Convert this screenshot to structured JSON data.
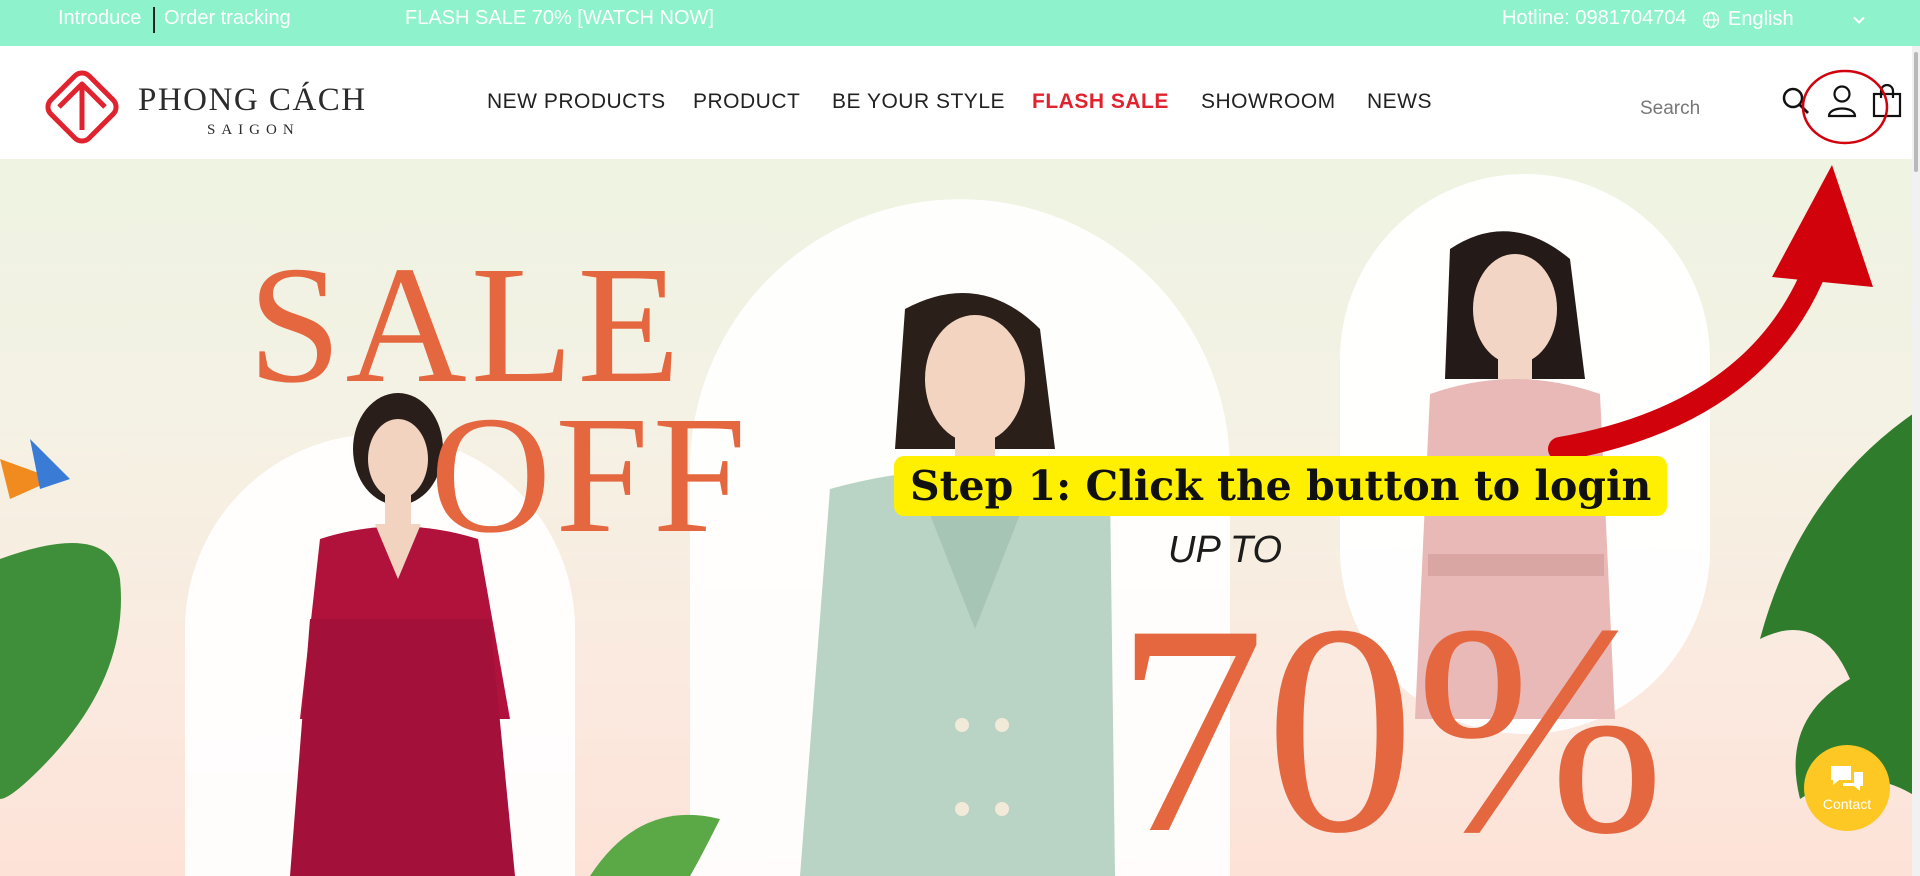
{
  "topbar": {
    "introduce": "Introduce",
    "order_tracking": "Order tracking",
    "promo": "FLASH SALE 70% [WATCH NOW]",
    "hotline": "Hotline: 0981704704",
    "language": "English"
  },
  "brand": {
    "name": "PHONG CÁCH",
    "sub": "SAIGON"
  },
  "nav": {
    "items": [
      "NEW PRODUCTS",
      "PRODUCT",
      "BE YOUR STYLE",
      "FLASH SALE",
      "SHOWROOM",
      "NEWS"
    ]
  },
  "search": {
    "placeholder": "Search"
  },
  "hero": {
    "sale": "SALE",
    "off": "OFF",
    "up_to": "UP TO",
    "percent": "70%"
  },
  "annotation": {
    "step": "Step 1: Click the button to login"
  },
  "contact": {
    "label": "Contact"
  },
  "colors": {
    "topbar": "#8ef2cc",
    "brand_red": "#e0232e",
    "sale_orange": "#e4673f",
    "callout_yellow": "#fef000",
    "contact_yellow": "#fdc824"
  }
}
